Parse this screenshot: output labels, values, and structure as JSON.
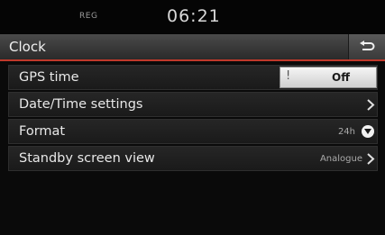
{
  "status": {
    "reg": "REG",
    "time": "06:21"
  },
  "header": {
    "title": "Clock"
  },
  "rows": {
    "gps": {
      "label": "GPS time",
      "toggle_mark": "!",
      "toggle_value": "Off"
    },
    "datetime": {
      "label": "Date/Time settings"
    },
    "format": {
      "label": "Format",
      "value": "24h"
    },
    "standby": {
      "label": "Standby screen view",
      "value": "Analogue"
    }
  },
  "colors": {
    "accent_red": "#c0392b"
  }
}
